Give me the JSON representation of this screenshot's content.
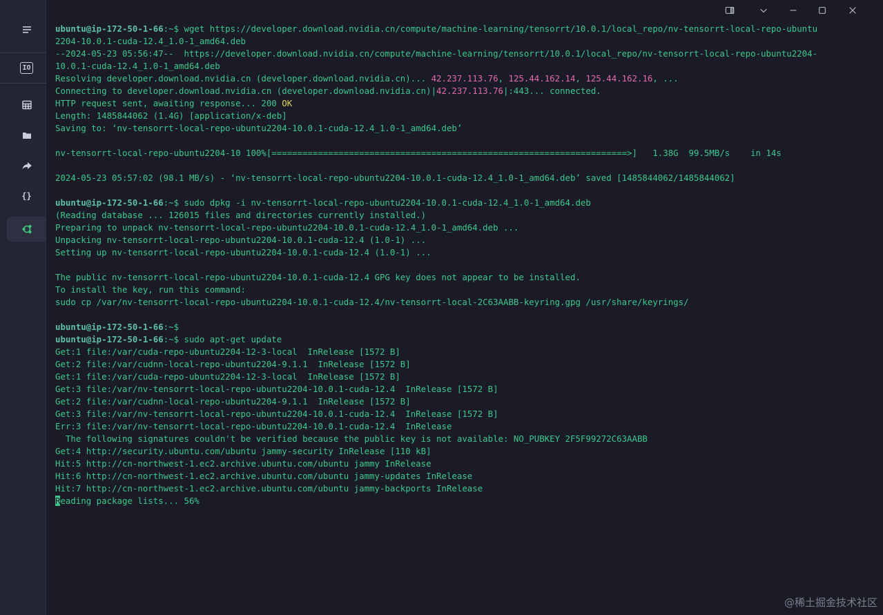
{
  "window_controls": [
    {
      "name": "panel-toggle-icon"
    },
    {
      "name": "chevron-down-icon"
    },
    {
      "name": "minimize-icon"
    },
    {
      "name": "maximize-icon"
    },
    {
      "name": "close-icon"
    }
  ],
  "sidebar": {
    "items": [
      {
        "icon": "menu-icon"
      },
      {
        "icon": "io-icon",
        "label": "IO"
      },
      {
        "icon": "grid-icon"
      },
      {
        "icon": "folder-icon"
      },
      {
        "icon": "forward-icon"
      },
      {
        "icon": "braces-icon",
        "label": "{}"
      },
      {
        "icon": "ubuntu-terminal-icon",
        "active": true
      }
    ]
  },
  "terminal": {
    "prompt": "ubuntu@ip-172-50-1-66",
    "lines": [
      [
        {
          "t": "ubuntu@ip-172-50-1-66",
          "c": "prompt"
        },
        {
          "t": ":~$ wget https://developer.download.nvidia.cn/compute/machine-learning/tensorrt/10.0.1/local_repo/nv-tensorrt-local-repo-ubuntu"
        }
      ],
      [
        {
          "t": "2204-10.0.1-cuda-12.4_1.0-1_amd64.deb"
        }
      ],
      [
        {
          "t": "--2024-05-23 05:56:47--  https://developer.download.nvidia.cn/compute/machine-learning/tensorrt/10.0.1/local_repo/nv-tensorrt-local-repo-ubuntu2204-"
        }
      ],
      [
        {
          "t": "10.0.1-cuda-12.4_1.0-1_amd64.deb"
        }
      ],
      [
        {
          "t": "Resolving developer.download.nvidia.cn (developer.download.nvidia.cn)... "
        },
        {
          "t": "42.237.113.76",
          "c": "pink"
        },
        {
          "t": ", "
        },
        {
          "t": "125.44.162.14",
          "c": "pink"
        },
        {
          "t": ", "
        },
        {
          "t": "125.44.162.16",
          "c": "pink"
        },
        {
          "t": ", ..."
        }
      ],
      [
        {
          "t": "Connecting to developer.download.nvidia.cn (developer.download.nvidia.cn)|"
        },
        {
          "t": "42.237.113.76",
          "c": "pink"
        },
        {
          "t": "|:443... connected."
        }
      ],
      [
        {
          "t": "HTTP request sent, awaiting response... 200 "
        },
        {
          "t": "OK",
          "c": "yellow"
        }
      ],
      [
        {
          "t": "Length: 1485844062 (1.4G) [application/x-deb]"
        }
      ],
      [
        {
          "t": "Saving to: ‘nv-tensorrt-local-repo-ubuntu2204-10.0.1-cuda-12.4_1.0-1_amd64.deb’"
        }
      ],
      [
        {
          "t": ""
        }
      ],
      [
        {
          "t": "nv-tensorrt-local-repo-ubuntu2204-10 100%[=====================================================================>]   1.38G  99.5MB/s    in 14s"
        }
      ],
      [
        {
          "t": ""
        }
      ],
      [
        {
          "t": "2024-05-23 05:57:02 (98.1 MB/s) - ‘nv-tensorrt-local-repo-ubuntu2204-10.0.1-cuda-12.4_1.0-1_amd64.deb’ saved [1485844062/1485844062]"
        }
      ],
      [
        {
          "t": ""
        }
      ],
      [
        {
          "t": "ubuntu@ip-172-50-1-66",
          "c": "prompt"
        },
        {
          "t": ":~$ sudo dpkg -i nv-tensorrt-local-repo-ubuntu2204-10.0.1-cuda-12.4_1.0-1_amd64.deb"
        }
      ],
      [
        {
          "t": "(Reading database ... 126015 files and directories currently installed.)"
        }
      ],
      [
        {
          "t": "Preparing to unpack nv-tensorrt-local-repo-ubuntu2204-10.0.1-cuda-12.4_1.0-1_amd64.deb ..."
        }
      ],
      [
        {
          "t": "Unpacking nv-tensorrt-local-repo-ubuntu2204-10.0.1-cuda-12.4 (1.0-1) ..."
        }
      ],
      [
        {
          "t": "Setting up nv-tensorrt-local-repo-ubuntu2204-10.0.1-cuda-12.4 (1.0-1) ..."
        }
      ],
      [
        {
          "t": ""
        }
      ],
      [
        {
          "t": "The public nv-tensorrt-local-repo-ubuntu2204-10.0.1-cuda-12.4 GPG key does not appear to be installed."
        }
      ],
      [
        {
          "t": "To install the key, run this command:"
        }
      ],
      [
        {
          "t": "sudo cp /var/nv-tensorrt-local-repo-ubuntu2204-10.0.1-cuda-12.4/nv-tensorrt-local-2C63AABB-keyring.gpg /usr/share/keyrings/"
        }
      ],
      [
        {
          "t": ""
        }
      ],
      [
        {
          "t": "ubuntu@ip-172-50-1-66",
          "c": "prompt"
        },
        {
          "t": ":~$"
        }
      ],
      [
        {
          "t": "ubuntu@ip-172-50-1-66",
          "c": "prompt"
        },
        {
          "t": ":~$ sudo apt-get update"
        }
      ],
      [
        {
          "t": "Get:1 file:/var/cuda-repo-ubuntu2204-12-3-local  InRelease [1572 B]"
        }
      ],
      [
        {
          "t": "Get:2 file:/var/cudnn-local-repo-ubuntu2204-9.1.1  InRelease [1572 B]"
        }
      ],
      [
        {
          "t": "Get:1 file:/var/cuda-repo-ubuntu2204-12-3-local  InRelease [1572 B]"
        }
      ],
      [
        {
          "t": "Get:3 file:/var/nv-tensorrt-local-repo-ubuntu2204-10.0.1-cuda-12.4  InRelease [1572 B]"
        }
      ],
      [
        {
          "t": "Get:2 file:/var/cudnn-local-repo-ubuntu2204-9.1.1  InRelease [1572 B]"
        }
      ],
      [
        {
          "t": "Get:3 file:/var/nv-tensorrt-local-repo-ubuntu2204-10.0.1-cuda-12.4  InRelease [1572 B]"
        }
      ],
      [
        {
          "t": "Err:3 file:/var/nv-tensorrt-local-repo-ubuntu2204-10.0.1-cuda-12.4  InRelease"
        }
      ],
      [
        {
          "t": "  The following signatures couldn't be verified because the public key is not available: NO_PUBKEY 2F5F99272C63AABB"
        }
      ],
      [
        {
          "t": "Get:4 http://security.ubuntu.com/ubuntu jammy-security InRelease [110 kB]"
        }
      ],
      [
        {
          "t": "Hit:5 http://cn-northwest-1.ec2.archive.ubuntu.com/ubuntu jammy InRelease"
        }
      ],
      [
        {
          "t": "Hit:6 http://cn-northwest-1.ec2.archive.ubuntu.com/ubuntu jammy-updates InRelease"
        }
      ],
      [
        {
          "t": "Hit:7 http://cn-northwest-1.ec2.archive.ubuntu.com/ubuntu jammy-backports InRelease"
        }
      ],
      [
        {
          "t": "R",
          "c": "cursor"
        },
        {
          "t": "eading package lists... 56%"
        }
      ]
    ]
  },
  "watermark": "@稀土掘金技术社区",
  "colors": {
    "background": "#1a1b26",
    "sidebar": "#232535",
    "text": "#3ec78e",
    "prompt": "#5fc0a6",
    "ip": "#e26ca9",
    "ok": "#e3d65b"
  }
}
